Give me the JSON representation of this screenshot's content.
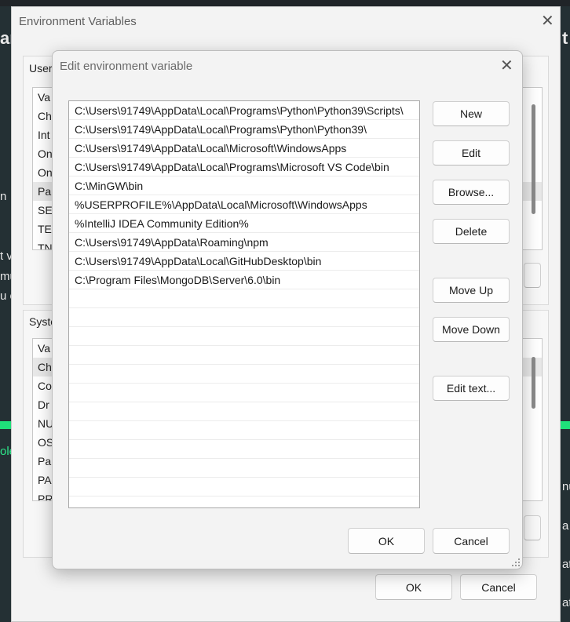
{
  "outer_dialog": {
    "title": "Environment Variables",
    "user_group_label": "User",
    "user_rows": [
      "Va",
      "Ch",
      "Int",
      "On",
      "On",
      "Pa",
      "SE",
      "TE",
      "TN"
    ],
    "system_group_label": "Syste",
    "system_rows": [
      "Va",
      "Ch",
      "Co",
      "Dr",
      "NU",
      "OS",
      "Pa",
      "PA",
      "PR"
    ],
    "ok_label": "OK",
    "cancel_label": "Cancel"
  },
  "background": {
    "left_fragments": [
      "ar",
      "n",
      "t v",
      "mu",
      "u o",
      "ole"
    ],
    "right_fragments": [
      "t",
      "nu",
      "a",
      "at",
      "at"
    ]
  },
  "edit_dialog": {
    "title": "Edit environment variable",
    "paths": [
      "C:\\Users\\91749\\AppData\\Local\\Programs\\Python\\Python39\\Scripts\\",
      "C:\\Users\\91749\\AppData\\Local\\Programs\\Python\\Python39\\",
      "C:\\Users\\91749\\AppData\\Local\\Microsoft\\WindowsApps",
      "C:\\Users\\91749\\AppData\\Local\\Programs\\Microsoft VS Code\\bin",
      "C:\\MinGW\\bin",
      "%USERPROFILE%\\AppData\\Local\\Microsoft\\WindowsApps",
      "%IntelliJ IDEA Community Edition%",
      "C:\\Users\\91749\\AppData\\Roaming\\npm",
      "C:\\Users\\91749\\AppData\\Local\\GitHubDesktop\\bin",
      "C:\\Program Files\\MongoDB\\Server\\6.0\\bin"
    ],
    "buttons": {
      "new": "New",
      "edit": "Edit",
      "browse": "Browse...",
      "delete": "Delete",
      "move_up": "Move Up",
      "move_down": "Move Down",
      "edit_text": "Edit text..."
    },
    "ok_label": "OK",
    "cancel_label": "Cancel"
  },
  "icons": {
    "close": "close-icon",
    "resize": "resize-grip-icon"
  }
}
